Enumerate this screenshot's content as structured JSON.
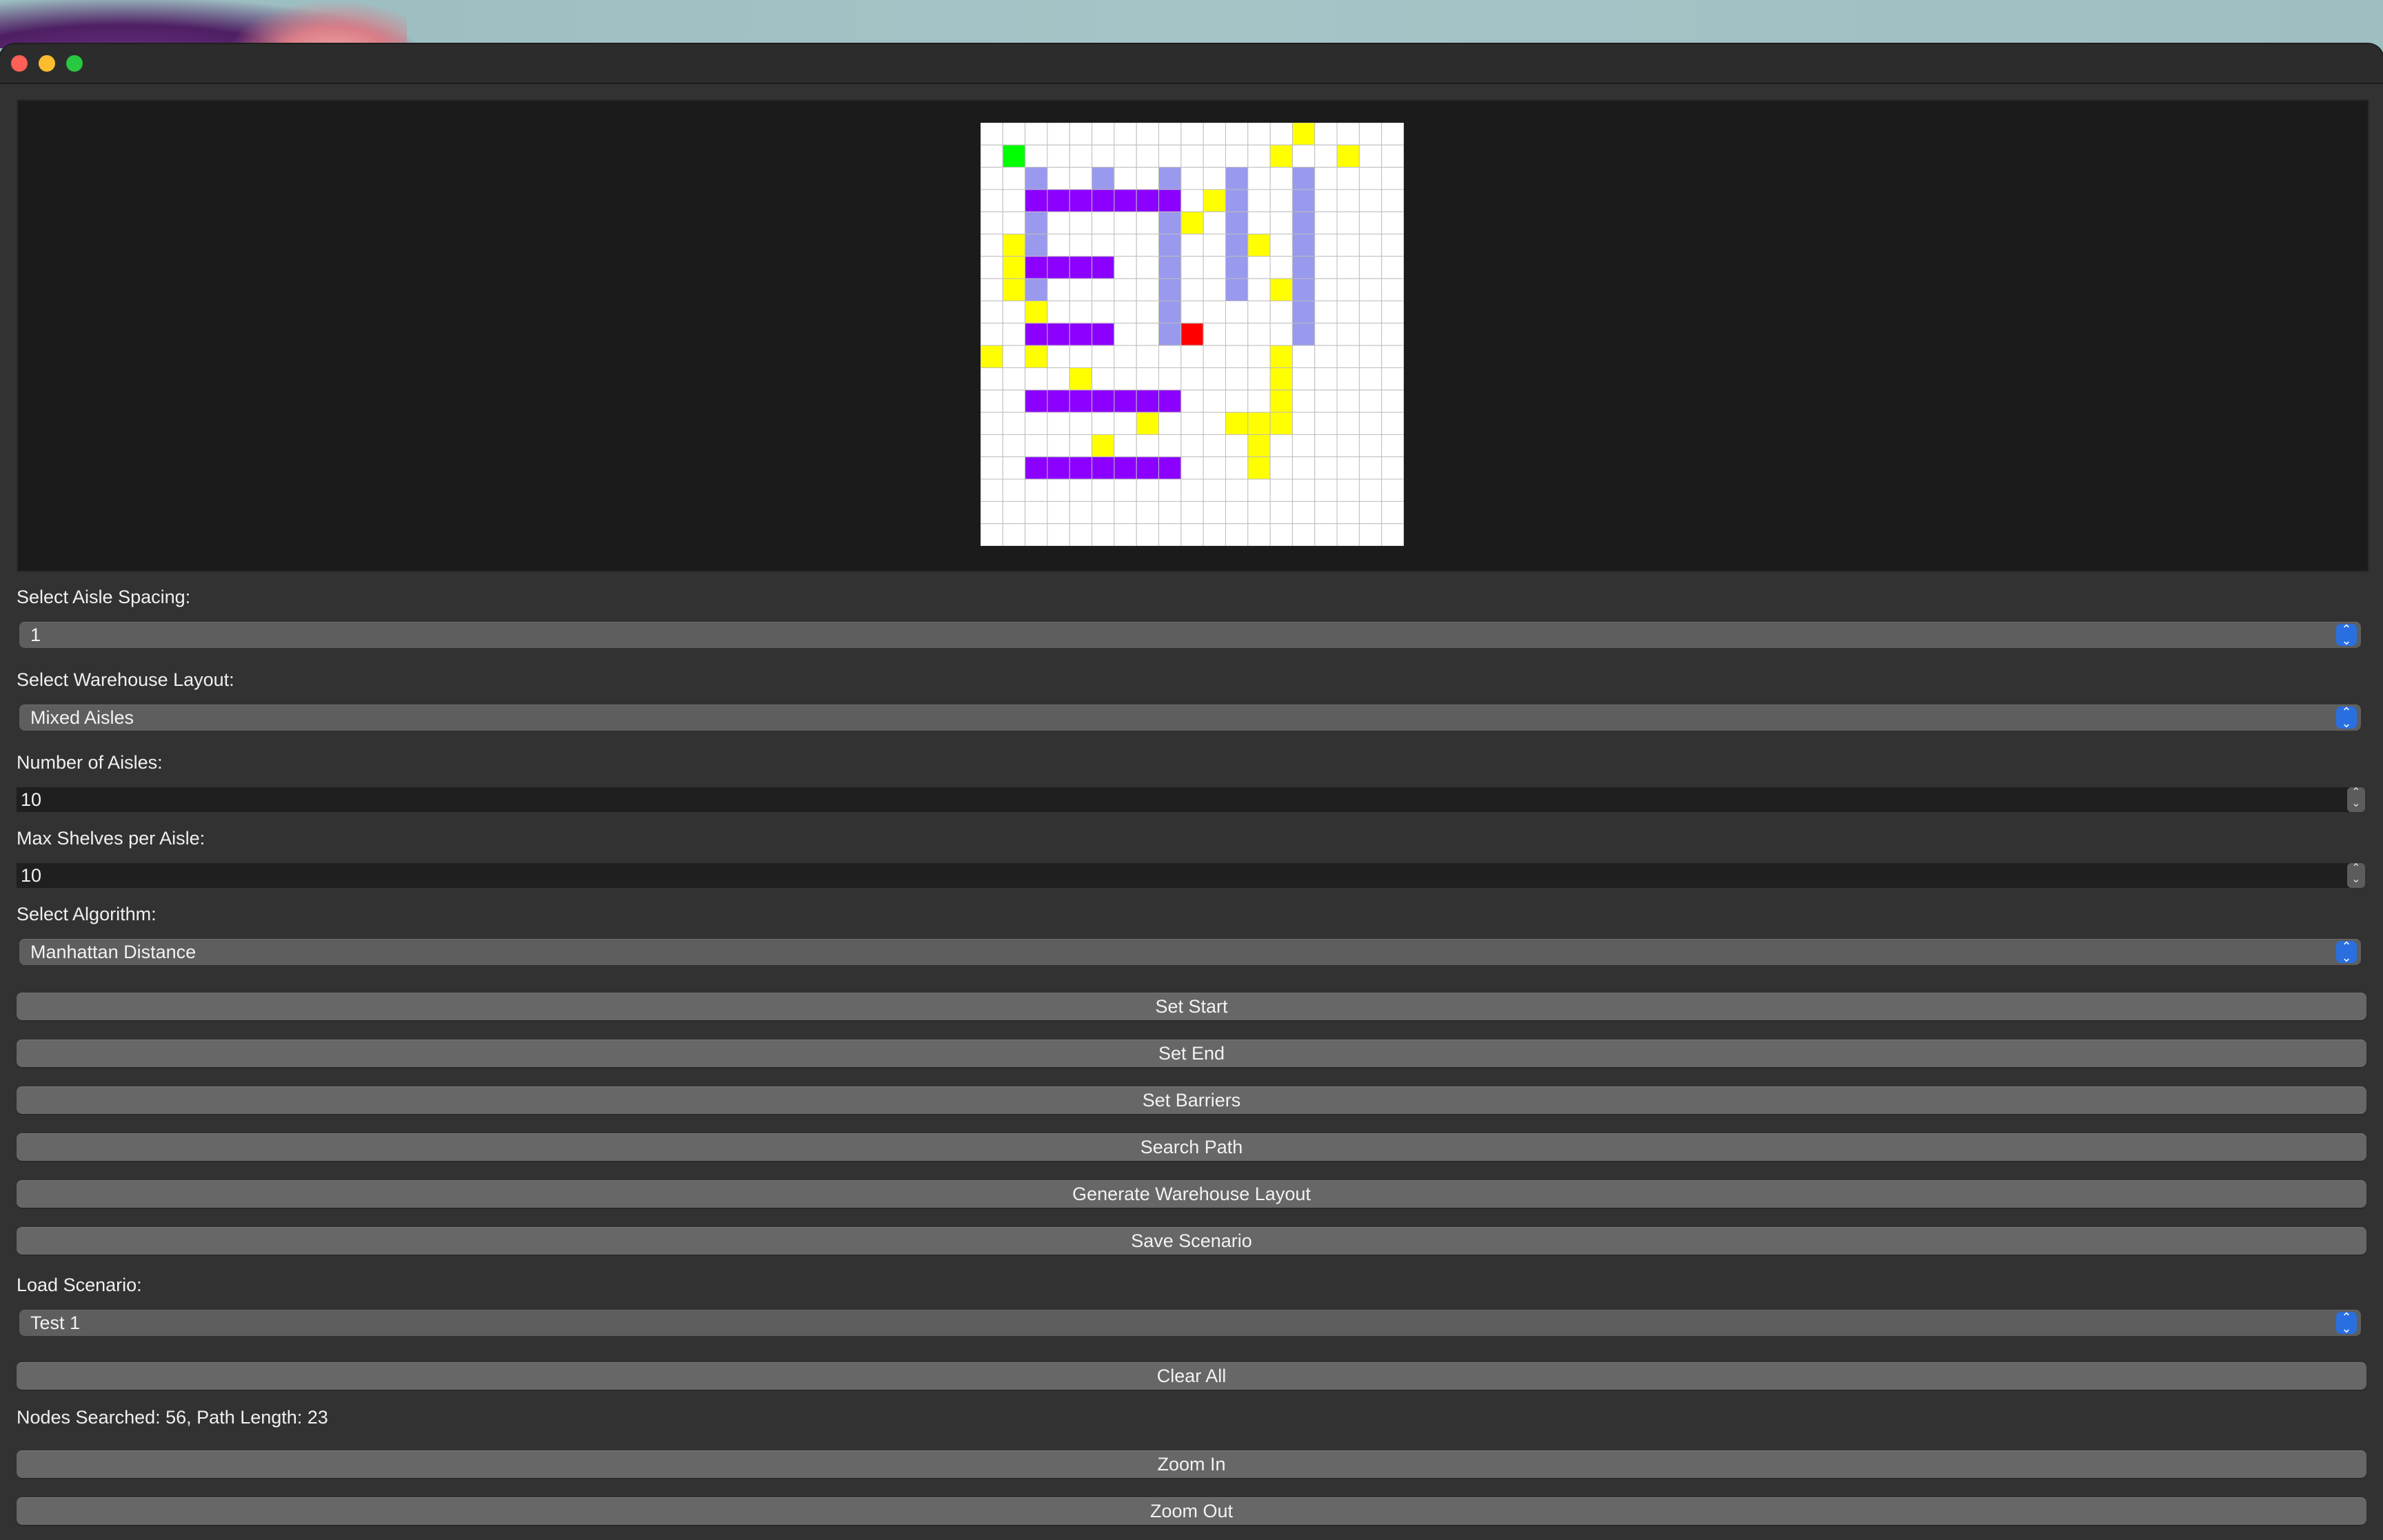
{
  "colors": {
    "window_bg": "#323232",
    "canvas_bg": "#1b1b1b",
    "start": "#00ff00",
    "end": "#ff0000",
    "shelf": "#8b00ff",
    "aisle": "#9999ee",
    "searched": "#ffff00",
    "empty": "#ffffff",
    "grid_line": "#bdbdbd",
    "accent": "#2a6fe0"
  },
  "grid": {
    "rows": 19,
    "cols": 19,
    "start": [
      1,
      1
    ],
    "end": [
      9,
      9
    ],
    "searched": [
      [
        0,
        14
      ],
      [
        1,
        13
      ],
      [
        1,
        16
      ],
      [
        3,
        10
      ],
      [
        4,
        9
      ],
      [
        5,
        1
      ],
      [
        5,
        12
      ],
      [
        6,
        1
      ],
      [
        7,
        1
      ],
      [
        7,
        13
      ],
      [
        8,
        2
      ],
      [
        10,
        0
      ],
      [
        10,
        2
      ],
      [
        10,
        13
      ],
      [
        11,
        4
      ],
      [
        11,
        13
      ],
      [
        12,
        13
      ],
      [
        13,
        7
      ],
      [
        13,
        11
      ],
      [
        13,
        12
      ],
      [
        13,
        13
      ],
      [
        14,
        5
      ],
      [
        14,
        12
      ],
      [
        15,
        12
      ]
    ],
    "shelves": [
      [
        3,
        2,
        8
      ],
      [
        6,
        2,
        5
      ],
      [
        9,
        2,
        5
      ],
      [
        12,
        2,
        8
      ],
      [
        15,
        2,
        8
      ]
    ],
    "aisles": [
      [
        2,
        2
      ],
      [
        2,
        5
      ],
      [
        2,
        8
      ],
      [
        2,
        11
      ],
      [
        2,
        14
      ],
      [
        3,
        11
      ],
      [
        3,
        14
      ],
      [
        4,
        2
      ],
      [
        4,
        8
      ],
      [
        4,
        11
      ],
      [
        4,
        14
      ],
      [
        5,
        2
      ],
      [
        5,
        8
      ],
      [
        5,
        11
      ],
      [
        5,
        14
      ],
      [
        6,
        8
      ],
      [
        6,
        11
      ],
      [
        6,
        14
      ],
      [
        7,
        2
      ],
      [
        7,
        8
      ],
      [
        7,
        11
      ],
      [
        7,
        14
      ],
      [
        8,
        8
      ],
      [
        8,
        14
      ],
      [
        9,
        8
      ],
      [
        9,
        14
      ]
    ]
  },
  "controls": {
    "aisle_spacing_label": "Select Aisle Spacing:",
    "aisle_spacing_value": "1",
    "layout_label": "Select Warehouse Layout:",
    "layout_value": "Mixed Aisles",
    "num_aisles_label": "Number of Aisles:",
    "num_aisles_value": "10",
    "max_shelves_label": "Max Shelves per Aisle:",
    "max_shelves_value": "10",
    "algorithm_label": "Select Algorithm:",
    "algorithm_value": "Manhattan Distance",
    "load_label": "Load Scenario:",
    "load_value": "Test 1"
  },
  "buttons": {
    "set_start": "Set Start",
    "set_end": "Set End",
    "set_barriers": "Set Barriers",
    "search_path": "Search Path",
    "generate_layout": "Generate Warehouse Layout",
    "save_scenario": "Save Scenario",
    "clear_all": "Clear All",
    "zoom_in": "Zoom In",
    "zoom_out": "Zoom Out"
  },
  "status": {
    "text": "Nodes Searched: 56, Path Length: 23"
  },
  "icons": {
    "combo_arrow": "chevron-up-down-icon",
    "spin_arrow": "stepper-icon"
  }
}
